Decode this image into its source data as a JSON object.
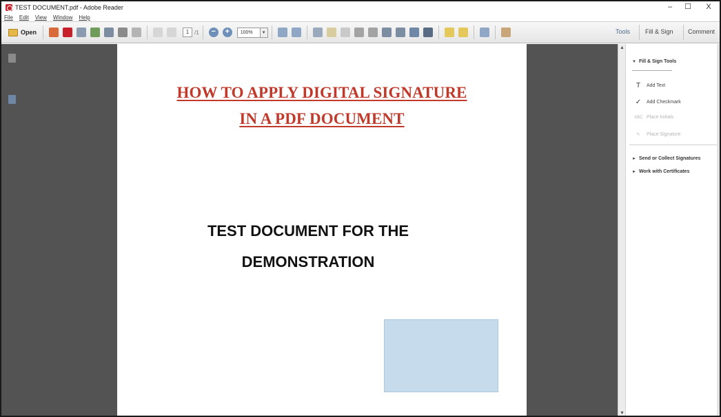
{
  "window": {
    "title": "TEST DOCUMENT.pdf - Adobe Reader",
    "minimize_glyph": "–",
    "maximize_glyph": "☐",
    "close_glyph": "X"
  },
  "menu": [
    "File",
    "Edit",
    "View",
    "Window",
    "Help"
  ],
  "toolbar": {
    "open_label": "Open",
    "page_number": "1",
    "page_total": "/1",
    "zoom_out": "−",
    "zoom_in": "+",
    "zoom_value": "100%",
    "zoom_dropdown": "▾",
    "icons": [
      "create-pdf-icon",
      "pdf-convert-icon",
      "edit-icon",
      "upload-cloud-icon",
      "save-icon",
      "print-icon",
      "email-icon",
      "previous-page-icon",
      "next-page-icon",
      "fit-width-icon",
      "fit-page-icon",
      "read-mode-icon",
      "comment-icon",
      "highlight-icon",
      "cut-icon",
      "copy-icon",
      "stamp-icon",
      "attach-icon",
      "find-icon",
      "tools-icon",
      "sticky-note-icon",
      "callout-icon",
      "expand-icon",
      "hand-tool-icon"
    ]
  },
  "tabs": {
    "tools": "Tools",
    "fill_sign": "Fill & Sign",
    "comment": "Comment"
  },
  "document": {
    "heading_line_1": "HOW TO APPLY DIGITAL SIGNATURE",
    "heading_line_2": "IN A PDF DOCUMENT",
    "body_line_1": "TEST DOCUMENT FOR THE",
    "body_line_2": "DEMONSTRATION"
  },
  "pane": {
    "fill_sign_tools": "Fill & Sign Tools",
    "add_text": "Add Text",
    "add_checkmark": "Add Checkmark",
    "place_initials": "Place Initials",
    "place_signature": "Place Signature",
    "send_collect": "Send or Collect Signatures",
    "work_certificates": "Work with Certificates"
  },
  "colors": {
    "heading_red": "#c0392b",
    "doc_background": "#535353",
    "signature_field": "#c6dcec",
    "tab_blue": "#4a6a8a"
  }
}
